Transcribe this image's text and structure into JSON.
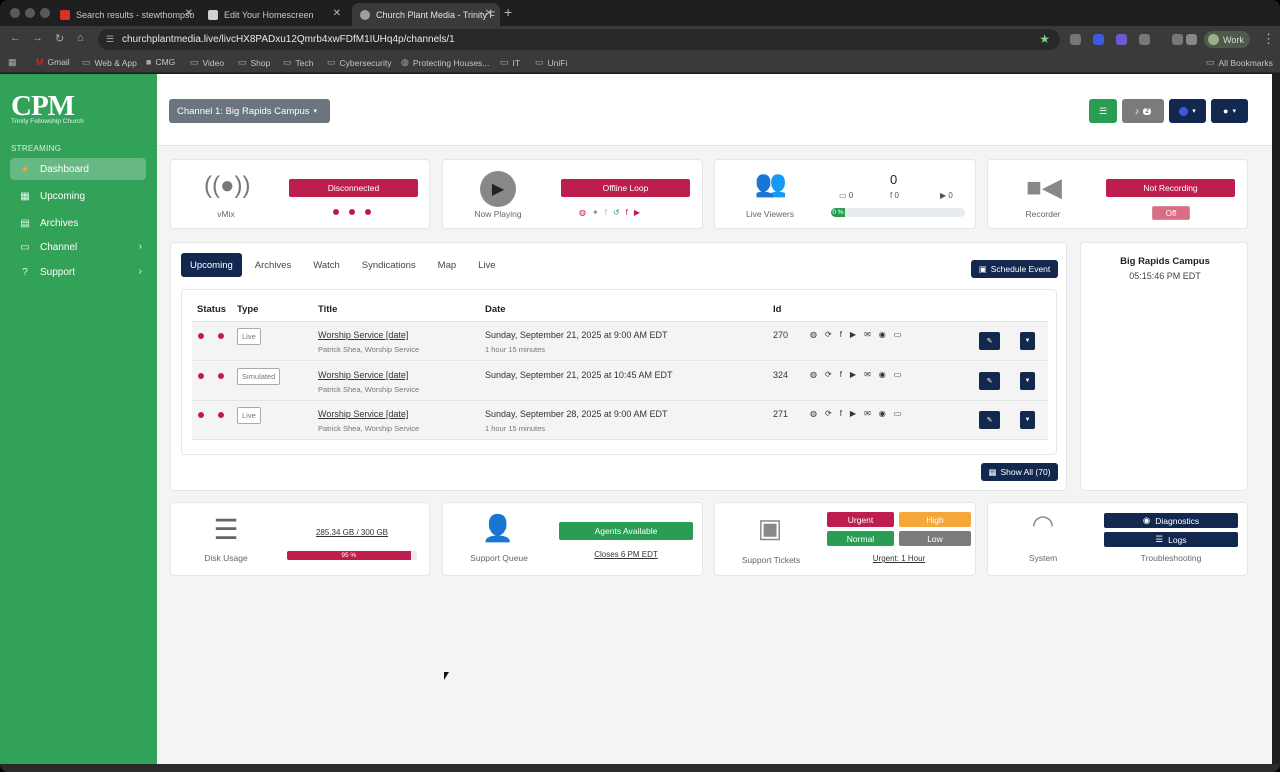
{
  "browser": {
    "tabs": [
      {
        "title": "Search results - stewthompso",
        "icon": "gmail-icon",
        "color": "#d93025"
      },
      {
        "title": "Edit Your Homescreen",
        "icon": "doc-icon",
        "color": "#cfcfcf"
      },
      {
        "title": "Church Plant Media - Trinity F",
        "icon": "globe-icon",
        "color": "#9aa0a6"
      }
    ],
    "url": "churchplantmedia.live/livcHX8PADxu12Qmrb4xwFDfM1IUHq4p/channels/1",
    "profile": "Work",
    "bookmarks": [
      "Gmail",
      "Web & App",
      "CMG",
      "Video",
      "Shop",
      "Tech",
      "Cybersecurity",
      "Protecting Houses...",
      "IT",
      "UniFi"
    ],
    "all_bookmarks": "All Bookmarks"
  },
  "sidebar": {
    "logo": "CPM",
    "org": "Trinity Fellowship Church",
    "section": "STREAMING",
    "items": [
      {
        "label": "Dashboard",
        "icon": "gauge-icon"
      },
      {
        "label": "Upcoming",
        "icon": "calendar-icon"
      },
      {
        "label": "Archives",
        "icon": "archive-icon"
      },
      {
        "label": "Channel",
        "icon": "monitor-icon"
      },
      {
        "label": "Support",
        "icon": "question-icon"
      }
    ]
  },
  "header": {
    "channel_select": "Channel 1: Big Rapids Campus",
    "notifications_count": "2"
  },
  "status": {
    "vmix": {
      "label": "vMix",
      "state": "Disconnected"
    },
    "now_playing": {
      "label": "Now Playing",
      "state": "Offline Loop"
    },
    "viewers": {
      "label": "Live Viewers",
      "total": "0",
      "web": "0",
      "facebook": "0",
      "youtube": "0",
      "progress_label": "0 %",
      "progress": 0
    },
    "recorder": {
      "label": "Recorder",
      "state": "Not Recording",
      "toggle": "Off"
    }
  },
  "tabs": [
    "Upcoming",
    "Archives",
    "Watch",
    "Syndications",
    "Map",
    "Live"
  ],
  "schedule_button": "Schedule Event",
  "table": {
    "headers": [
      "Status",
      "Type",
      "Title",
      "Date",
      "Id"
    ],
    "rows": [
      {
        "type": "Live",
        "title": "Worship Service [date]",
        "people": "Patrick Shea, Worship Service",
        "date": "Sunday, September 21, 2025 at 9:00 AM EDT",
        "duration": "1 hour 15 minutes",
        "id": "270"
      },
      {
        "type": "Simulated",
        "title": "Worship Service [date]",
        "people": "Patrick Shea, Worship Service",
        "date": "Sunday, September 21, 2025 at 10:45 AM EDT",
        "duration": "",
        "id": "324"
      },
      {
        "type": "Live",
        "title": "Worship Service [date]",
        "people": "Patrick Shea, Worship Service",
        "date": "Sunday, September 28, 2025 at 9:00 AM EDT",
        "duration": "1 hour 15 minutes",
        "id": "271"
      }
    ]
  },
  "show_all": "Show All (70)",
  "campus": {
    "name": "Big Rapids Campus",
    "time": "05:15:46 PM EDT"
  },
  "disk": {
    "label": "Disk Usage",
    "usage": "285.34 GB / 300 GB",
    "percent_label": "95 %",
    "percent": 95
  },
  "support_queue": {
    "label": "Support Queue",
    "status": "Agents Available",
    "closes": "Closes 6 PM EDT"
  },
  "tickets": {
    "label": "Support Tickets",
    "urgent": "Urgent",
    "high": "High",
    "normal": "Normal",
    "low": "Low",
    "summary": "Urgent: 1 Hour"
  },
  "system": {
    "label": "System",
    "diagnostics": "Diagnostics",
    "logs": "Logs",
    "troubleshooting": "Troubleshooting"
  },
  "colors": {
    "sidebar": "#33a259",
    "navy": "#13284f",
    "red": "#be1e4d",
    "green": "#2a9d55",
    "orange": "#f5a73a"
  }
}
